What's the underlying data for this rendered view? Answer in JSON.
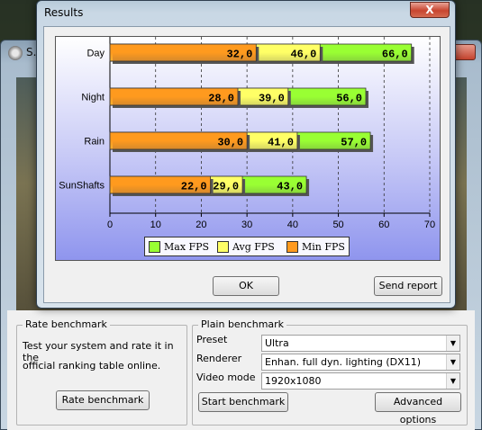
{
  "back_window": {
    "title": "S."
  },
  "results_dialog": {
    "title": "Results",
    "close_symbol": "X",
    "ok_label": "OK",
    "send_report_label": "Send report"
  },
  "chart_data": {
    "type": "bar",
    "orientation": "horizontal",
    "stacked": true,
    "categories": [
      "Day",
      "Night",
      "Rain",
      "SunShafts"
    ],
    "series": [
      {
        "name": "Min FPS",
        "values": [
          32.0,
          28.0,
          30.0,
          22.0
        ],
        "labels": [
          "32,0",
          "28,0",
          "30,0",
          "22,0"
        ],
        "color": "#ff9a1e"
      },
      {
        "name": "Avg FPS",
        "values": [
          46.0,
          39.0,
          41.0,
          29.0
        ],
        "labels": [
          "46,0",
          "39,0",
          "41,0",
          "29,0"
        ],
        "color": "#ffff66"
      },
      {
        "name": "Max FPS",
        "values": [
          66.0,
          56.0,
          57.0,
          43.0
        ],
        "labels": [
          "66,0",
          "56,0",
          "57,0",
          "43,0"
        ],
        "color": "#99ff33"
      }
    ],
    "xlim": [
      0,
      70
    ],
    "xticks": [
      "0",
      "10",
      "20",
      "30",
      "40",
      "50",
      "60",
      "70"
    ],
    "grid": "vertical-dashed",
    "legend": {
      "position": "bottom",
      "entries": [
        "Max FPS",
        "Avg FPS",
        "Min FPS"
      ]
    },
    "title": "",
    "xlabel": "",
    "ylabel": ""
  },
  "rate_benchmark": {
    "group_title": "Rate benchmark",
    "description_line1": "Test your system and rate it in the",
    "description_line2": "official ranking table online.",
    "button_label": "Rate benchmark"
  },
  "plain_benchmark": {
    "group_title": "Plain benchmark",
    "preset_label": "Preset",
    "preset_value": "Ultra",
    "renderer_label": "Renderer",
    "renderer_value": "Enhan. full dyn. lighting (DX11)",
    "video_mode_label": "Video mode",
    "video_mode_value": "1920x1080",
    "start_label": "Start benchmark",
    "advanced_label": "Advanced options"
  }
}
